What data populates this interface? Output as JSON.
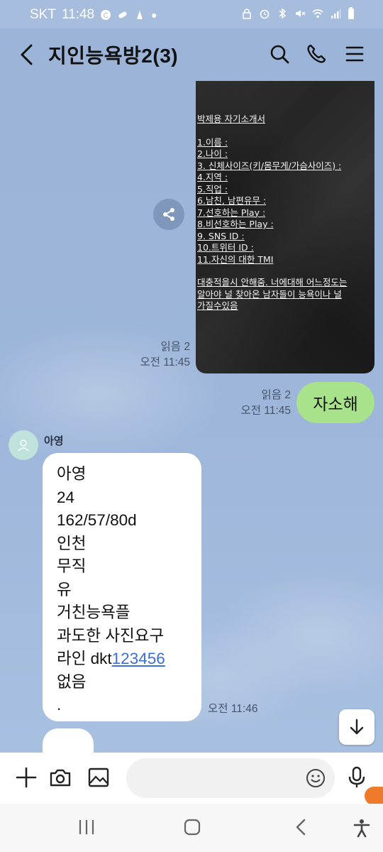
{
  "status": {
    "carrier": "SKT",
    "time": "11:48"
  },
  "header": {
    "title": "지인능욕방2(3)"
  },
  "photo": {
    "title": "박제용 자기소개서",
    "fields": [
      "1.이름 :",
      "2.나이 :",
      "3. 신체사이즈(키/몸무게/가슴사이즈) :",
      "4.지역 :",
      "5.직업 :",
      "6.남친, 남편유무 :",
      "7.선호하는 Play :",
      "8.비선호하는 Play :",
      "9. SNS ID :",
      "10.트위터 ID :",
      "11.자신의 대한 TMI"
    ],
    "note": [
      "대충적을시 안해줌. 너에대해 어느정도는",
      "알아야 널 찾아온 남자들이 능욕이나 널",
      "가질수있음"
    ]
  },
  "messages": {
    "photo_read": "읽음 2",
    "photo_time": "오전 11:45",
    "mine_read": "읽음 2",
    "mine_time": "오전 11:45",
    "mine_text": "자소해",
    "sender": "아영",
    "reply_lines": [
      "아영",
      "24",
      "162/57/80d",
      "인천",
      "무직",
      "유",
      "거친능욕플",
      "과도한 사진요구"
    ],
    "line_id_prefix": "라인 dkt",
    "line_id_link": "123456",
    "reply_tail": [
      "없음",
      "."
    ],
    "reply_time": "오전 11:46"
  }
}
